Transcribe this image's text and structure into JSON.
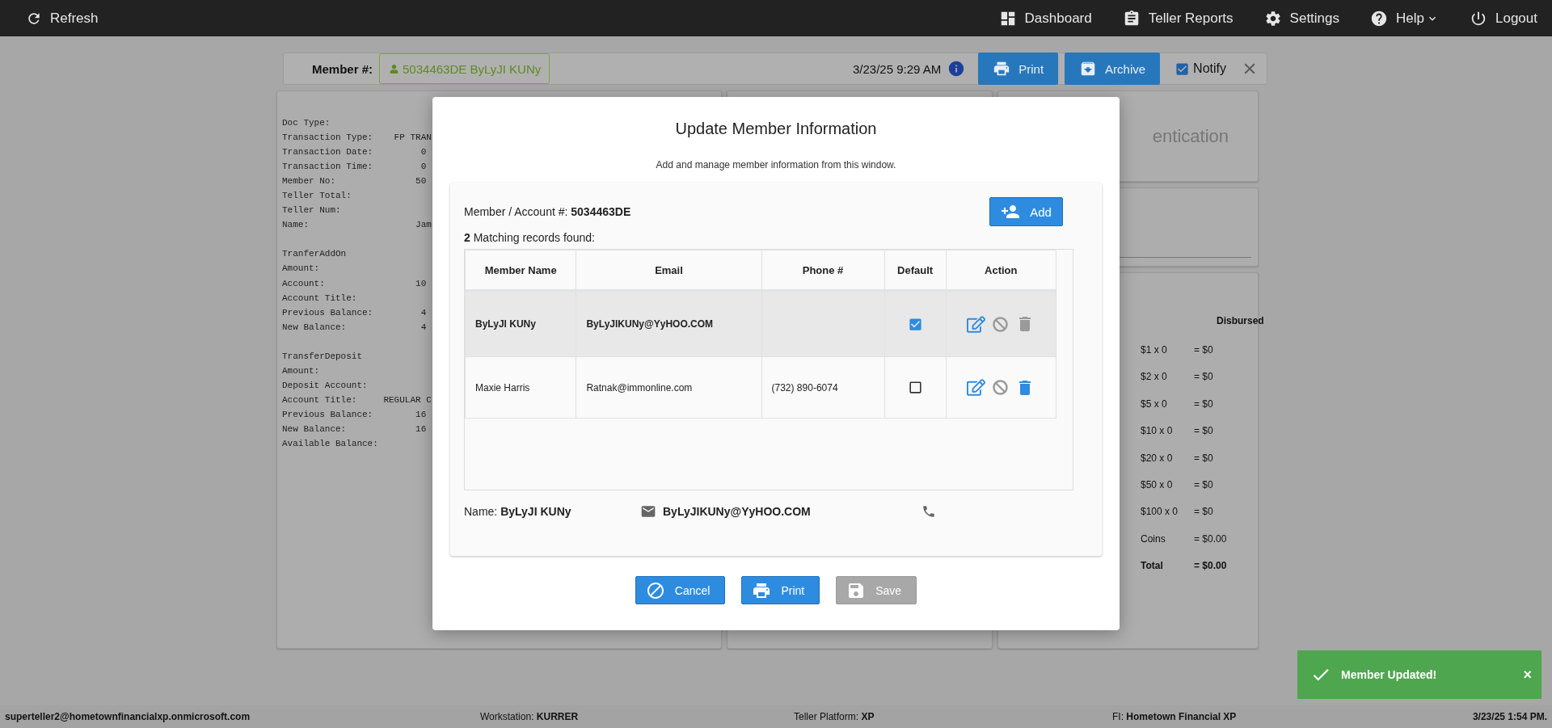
{
  "topbar": {
    "refresh": "Refresh",
    "items": [
      {
        "kind": "dashboard",
        "label": "Dashboard"
      },
      {
        "kind": "reports",
        "label": "Teller Reports"
      },
      {
        "kind": "settings",
        "label": "Settings"
      },
      {
        "kind": "help",
        "label": "Help",
        "menu": true
      },
      {
        "kind": "logout",
        "label": "Logout"
      }
    ]
  },
  "member_bar": {
    "label": "Member #:",
    "member": "5034463DE ByLyJI KUNy",
    "datetime": "3/23/25 9:29 AM",
    "buttons": [
      {
        "kind": "print",
        "label": "Print"
      },
      {
        "kind": "archive",
        "label": "Archive"
      }
    ],
    "notify": {
      "label": "Notify",
      "checked": true
    }
  },
  "receipt": {
    "sections": [
      {
        "lines": [
          "Doc Type:",
          "Transaction Type:    FP TRAN",
          "Transaction Date:         0",
          "Transaction Time:         0",
          "Member No:               50",
          "Teller Total:",
          "Teller Num:",
          "Name:                    Jam"
        ]
      },
      {
        "lines": [
          "TranferAddOn",
          "Amount:",
          "Account:                 10",
          "Account Title:",
          "Previous Balance:         4",
          "New Balance:              4"
        ]
      },
      {
        "lines": [
          "TransferDeposit",
          "Amount:",
          "Deposit Account:",
          "Account Title:     REGULAR C",
          "Previous Balance:        16",
          "New Balance:             16",
          "Available Balance:"
        ]
      }
    ]
  },
  "auth_panel": {
    "title": "entication"
  },
  "disbursed": {
    "title": "Disbursed",
    "rows": [
      {
        "kind": "line",
        "label": "$1 x 0",
        "amount": "= $0"
      },
      {
        "kind": "line",
        "label": "$2 x 0",
        "amount": "= $0"
      },
      {
        "kind": "line",
        "label": "$5 x 0",
        "amount": "= $0"
      },
      {
        "kind": "line",
        "label": "$10 x 0",
        "amount": "= $0"
      },
      {
        "kind": "line",
        "label": "$20 x 0",
        "amount": "= $0"
      },
      {
        "kind": "line",
        "label": "$50 x 0",
        "amount": "= $0"
      },
      {
        "kind": "line",
        "label": "$100 x 0",
        "amount": "= $0"
      },
      {
        "kind": "line",
        "label": "Coins",
        "amount": "= $0.00"
      },
      {
        "kind": "total",
        "label": "Total",
        "amount": "= $0.00"
      }
    ]
  },
  "modal": {
    "title": "Update Member Information",
    "subtitle": "Add and manage member information from this window.",
    "account_label": "Member / Account #:",
    "account": "5034463DE",
    "add_button": "Add",
    "match_count": "2",
    "match_text": "Matching records found:",
    "columns": [
      "Member Name",
      "Email",
      "Phone #",
      "Default",
      "Action"
    ],
    "rows": [
      {
        "name": "ByLyJI KUNy",
        "email": "ByLyJIKUNy@YyHOO.COM",
        "selected": true,
        "default": true,
        "delete_enabled": false
      },
      {
        "name": "Maxie Harris",
        "email": "Ratnak@immonline.com",
        "phone": "(732) 890-6074",
        "selected": false,
        "default": false,
        "delete_enabled": true
      }
    ],
    "summary": {
      "name_label": "Name:",
      "name": "ByLyJI KUNy",
      "email": "ByLyJIKUNy@YyHOO.COM"
    },
    "buttons": [
      {
        "kind": "cancel",
        "label": "Cancel",
        "disabled": false
      },
      {
        "kind": "print",
        "label": "Print",
        "disabled": false
      },
      {
        "kind": "save",
        "label": "Save",
        "disabled": true
      }
    ]
  },
  "toast": {
    "message": "Member Updated!",
    "close": "×"
  },
  "status_bar": {
    "user": "superteller2@hometownfinancialxp.onmicrosoft.com",
    "fields": [
      {
        "label": "Workstation:",
        "value": "KURRER"
      },
      {
        "label": "Teller Platform:",
        "value": "XP"
      },
      {
        "label": "FI:",
        "value": "Hometown Financial XP"
      }
    ],
    "datetime": "3/23/25 1:54 PM."
  }
}
